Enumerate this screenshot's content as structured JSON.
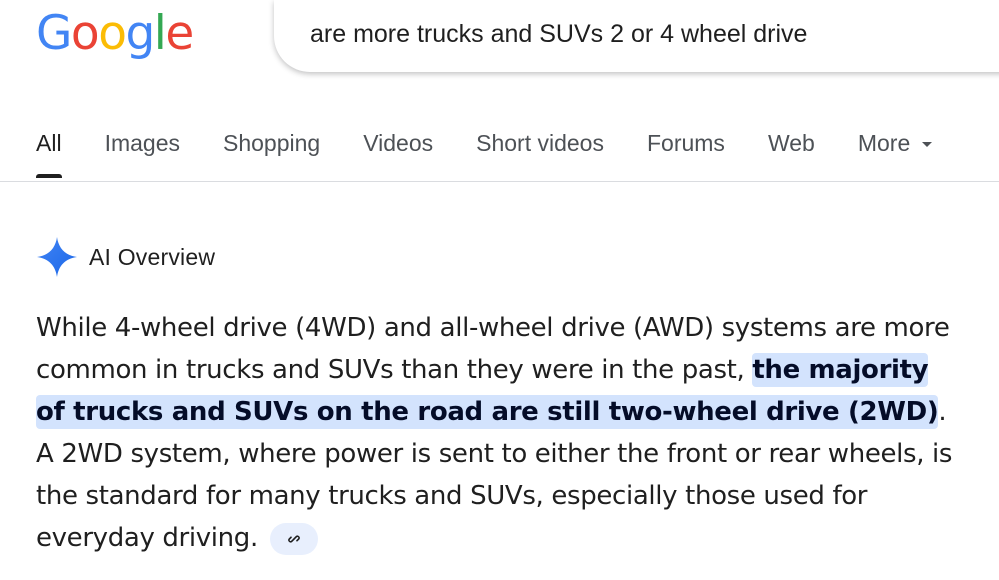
{
  "logo": {
    "letters": [
      "G",
      "o",
      "o",
      "g",
      "l",
      "e"
    ],
    "colors": [
      "#4285F4",
      "#EA4335",
      "#FBBC05",
      "#4285F4",
      "#34A853",
      "#EA4335"
    ]
  },
  "search": {
    "query": "are more trucks and SUVs 2 or 4 wheel drive"
  },
  "tabs": [
    {
      "label": "All",
      "active": true
    },
    {
      "label": "Images"
    },
    {
      "label": "Shopping"
    },
    {
      "label": "Videos"
    },
    {
      "label": "Short videos"
    },
    {
      "label": "Forums"
    },
    {
      "label": "Web"
    },
    {
      "label": "More",
      "icon": "chevron-down-icon"
    }
  ],
  "ai_overview": {
    "icon": "sparkle-icon",
    "title": "AI Overview",
    "paragraph": {
      "before": "While 4-wheel drive (4WD) and all-wheel drive (AWD) systems are more common in trucks and SUVs than they were in the past, ",
      "highlight": "the majority of trucks and SUVs on the road are still two-wheel drive (2WD)",
      "after": ". A 2WD system, where power is sent to either the front or rear wheels, is the standard for many trucks and SUVs, especially those used for everyday driving."
    },
    "link_icon": "link-icon"
  },
  "colors": {
    "highlight_bg": "#d3e3fd",
    "tab_text": "#4d5156",
    "link_chip_bg": "#e8effd"
  }
}
